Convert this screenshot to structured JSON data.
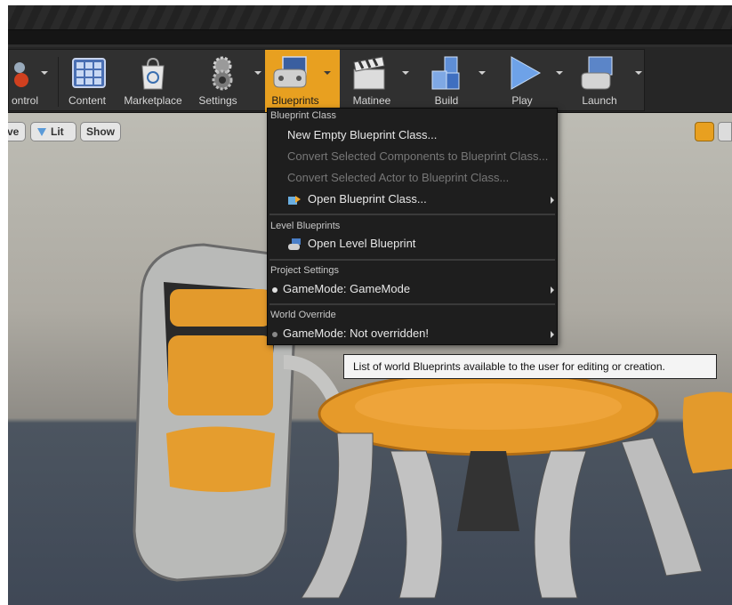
{
  "toolbar": {
    "items": [
      {
        "label": "ontrol",
        "icon": "source-control-icon"
      },
      {
        "label": "Content",
        "icon": "content-browser-icon"
      },
      {
        "label": "Marketplace",
        "icon": "marketplace-bag-icon"
      },
      {
        "label": "Settings",
        "icon": "settings-gears-icon"
      },
      {
        "label": "Blueprints",
        "icon": "blueprints-gamepad-icon"
      },
      {
        "label": "Matinee",
        "icon": "clapperboard-icon"
      },
      {
        "label": "Build",
        "icon": "build-blocks-icon"
      },
      {
        "label": "Play",
        "icon": "play-triangle-icon"
      },
      {
        "label": "Launch",
        "icon": "launch-console-icon"
      }
    ],
    "active": "Blueprints",
    "accent": "#e8a020"
  },
  "viewport": {
    "buttons": [
      "ve",
      "Lit",
      "Show"
    ]
  },
  "menu": {
    "sections": [
      {
        "title": "Blueprint Class",
        "items": [
          {
            "label": "New Empty Blueprint Class...",
            "enabled": true
          },
          {
            "label": "Convert Selected Components to Blueprint Class...",
            "enabled": false
          },
          {
            "label": "Convert Selected Actor to Blueprint Class...",
            "enabled": false
          },
          {
            "label": "Open Blueprint Class...",
            "enabled": true,
            "icon": "open-blueprint-icon",
            "submenu": true
          }
        ]
      },
      {
        "title": "Level Blueprints",
        "items": [
          {
            "label": "Open Level Blueprint",
            "enabled": true,
            "icon": "level-blueprint-icon"
          }
        ]
      },
      {
        "title": "Project Settings",
        "items": [
          {
            "label": "GameMode: GameMode",
            "enabled": true,
            "submenu": true
          }
        ]
      },
      {
        "title": "World Override",
        "items": [
          {
            "label": "GameMode: Not overridden!",
            "enabled": true,
            "submenu": true
          }
        ]
      }
    ]
  },
  "tooltip": "List of world Blueprints available to the user for editing or creation."
}
